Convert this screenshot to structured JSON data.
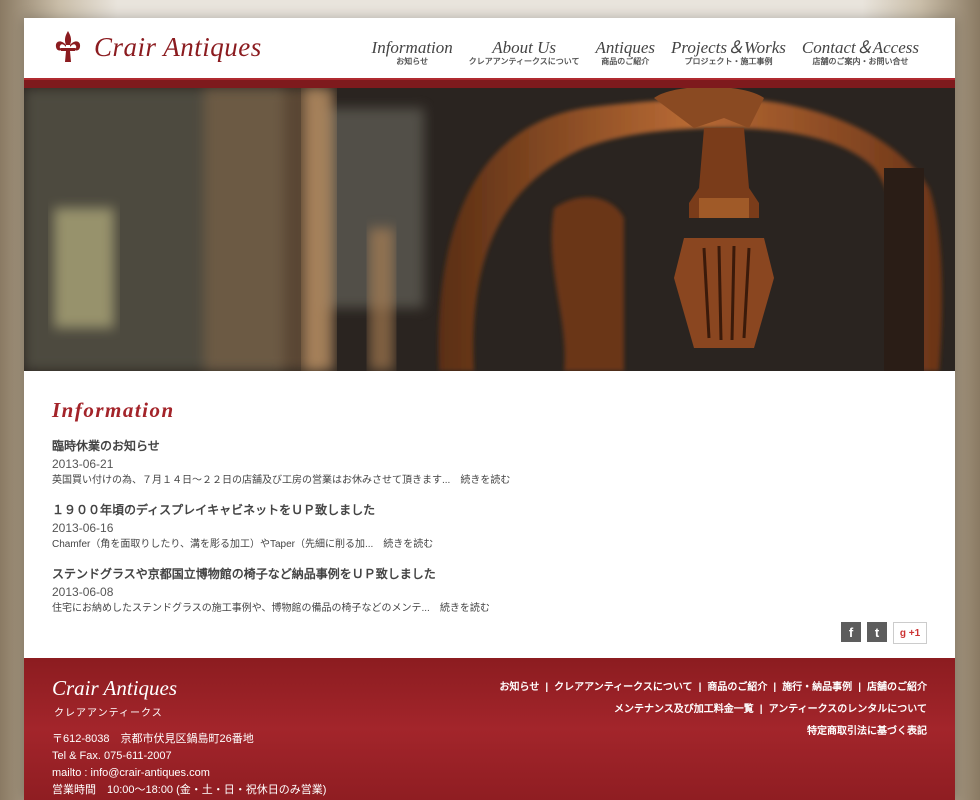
{
  "header": {
    "logo_text": "Crair Antiques",
    "nav": [
      {
        "en": "Information",
        "ja": "お知らせ"
      },
      {
        "en": "About Us",
        "ja": "クレアアンティークスについて"
      },
      {
        "en": "Antiques",
        "ja": "商品のご紹介"
      },
      {
        "en": "Projects＆Works",
        "ja": "プロジェクト・施工事例"
      },
      {
        "en": "Contact＆Access",
        "ja": "店舗のご案内・お問い合せ"
      }
    ]
  },
  "info": {
    "title": "Information",
    "items": [
      {
        "title": "臨時休業のお知らせ",
        "date": "2013-06-21",
        "text": "英国買い付けの為、７月１４日〜２２日の店舗及び工房の営業はお休みさせて頂きます...",
        "more": "続きを読む"
      },
      {
        "title": "１９００年頃のディスプレイキャビネットをＵＰ致しました",
        "date": "2013-06-16",
        "text": "Chamfer（角を面取りしたり、溝を彫る加工）やTaper（先細に削る加...",
        "more": "続きを読む"
      },
      {
        "title": "ステンドグラスや京都国立博物館の椅子など納品事例をＵＰ致しました",
        "date": "2013-06-08",
        "text": "住宅にお納めしたステンドグラスの施工事例や、博物館の備品の椅子などのメンテ...",
        "more": "続きを読む"
      }
    ]
  },
  "social": {
    "fb": "f",
    "tw": "t",
    "gp": "g +1"
  },
  "footer": {
    "logo": "Crair Antiques",
    "kana": "クレアアンティークス",
    "address": "〒612-8038　京都市伏見区鍋島町26番地",
    "tel": "Tel & Fax. 075-611-2007",
    "mail": "mailto : info@crair-antiques.com",
    "hours": "営業時間　10:00〜18:00 (金・土・日・祝休日のみ営業)",
    "links_row1": [
      "お知らせ",
      "クレアアンティークスについて",
      "商品のご紹介",
      "施行・納品事例",
      "店舗のご紹介"
    ],
    "links_row2": [
      "メンテナンス及び加工料金一覧",
      "アンティークスのレンタルについて"
    ],
    "links_row3": [
      "特定商取引法に基づく表記"
    ]
  },
  "colors": {
    "brand": "#8b1b1f",
    "accent": "#a32329",
    "footer_bg": "#9a2227"
  }
}
